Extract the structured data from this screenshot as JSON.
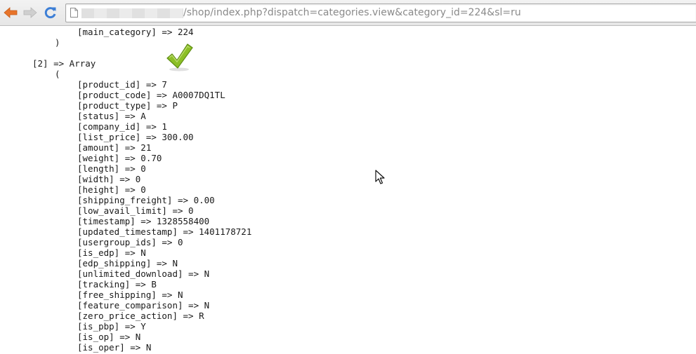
{
  "browser": {
    "url_host": "",
    "url_path": "/shop/index.php?dispatch=categories.view&category_id=224&sl=ru"
  },
  "content": {
    "top_lines": [
      "[main_category] => 224",
      ")"
    ],
    "array_header": "[2] => Array",
    "open_paren": "(",
    "fields": [
      "[product_id] => 7",
      "[product_code] => A0007DQ1TL",
      "[product_type] => P",
      "[status] => A",
      "[company_id] => 1",
      "[list_price] => 300.00",
      "[amount] => 21",
      "[weight] => 0.70",
      "[length] => 0",
      "[width] => 0",
      "[height] => 0",
      "[shipping_freight] => 0.00",
      "[low_avail_limit] => 0",
      "[timestamp] => 1328558400",
      "[updated_timestamp] => 1401178721",
      "[usergroup_ids] => 0",
      "[is_edp] => N",
      "[edp_shipping] => N",
      "[unlimited_download] => N",
      "[tracking] => B",
      "[free_shipping] => N",
      "[feature_comparison] => N",
      "[zero_price_action] => R",
      "[is_pbp] => Y",
      "[is_op] => N",
      "[is_oper] => N"
    ]
  },
  "colors": {
    "toolbar_arrow": "#e8742a",
    "reload": "#3d7fd6",
    "check_green": "#8cbf26"
  },
  "icons": {
    "back": "arrow-left-icon",
    "forward": "arrow-right-icon",
    "reload": "reload-icon",
    "page": "page-icon",
    "check": "checkmark-icon",
    "cursor": "mouse-cursor-icon"
  }
}
